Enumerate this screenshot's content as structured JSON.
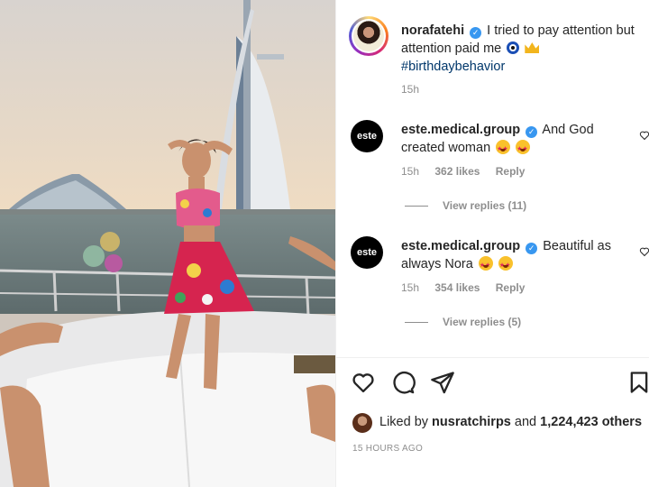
{
  "post": {
    "username": "norafatehi",
    "caption_text": "I tried to pay attention but attention paid me",
    "hashtag": "#birthdaybehavior",
    "time": "15h"
  },
  "icons": {
    "verified": "verified-badge-icon",
    "nazar": "nazar-amulet-emoji",
    "crown": "crown-emoji",
    "star_eyes": "star-struck-emoji"
  },
  "comments": [
    {
      "avatar_text": "este",
      "username": "este.medical.group",
      "text": "And God created woman",
      "time": "15h",
      "likes": "362 likes",
      "reply": "Reply",
      "view_replies": "View replies (11)"
    },
    {
      "avatar_text": "este",
      "username": "este.medical.group",
      "text": "Beautiful as always Nora",
      "time": "15h",
      "likes": "354 likes",
      "reply": "Reply",
      "view_replies": "View replies (5)"
    }
  ],
  "likes_line": {
    "prefix": "Liked by",
    "user": "nusratchirps",
    "middle": "and",
    "count": "1,224,423 others"
  },
  "timestamp": "15 HOURS AGO",
  "colors": {
    "verified": "#3897f0",
    "hashtag": "#00376b",
    "muted": "#8e8e8e",
    "text": "#262626"
  }
}
